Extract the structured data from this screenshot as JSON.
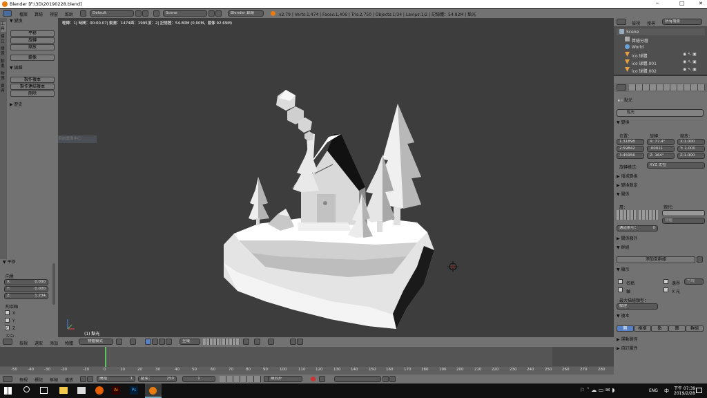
{
  "window": {
    "title": "Blender [F:\\3D\\20190228.blend]",
    "min": "─",
    "max": "□",
    "close": "✕"
  },
  "topbar": {
    "menu": [
      "檔案",
      "算繪",
      "視窗",
      "幫助"
    ],
    "layout": "Default",
    "scene": "Scene",
    "engine": "Blender 算繪",
    "stats": "v2.79 | Verts:1,474 | Faces:1,406 | Tris:2,750 | Objects:1/34 | Lamps:1/2 | 記憶體：54.82M | 點光"
  },
  "toolshelf": {
    "tabs": [
      "工具",
      "建立",
      "關係",
      "動畫",
      "物理",
      "寶典"
    ],
    "transform_header": "▼ 變換",
    "transform": [
      "平移",
      "旋轉",
      "縮放"
    ],
    "mirror": "鏡像",
    "edit_header": "▼ 編輯",
    "edit": [
      "製作複本",
      "製作連結複本",
      "刪除"
    ],
    "history": "▶ 歷史",
    "op_header": "▼ 平移",
    "vector": "向量",
    "x_label": "X:",
    "x_val": "0.000",
    "y_label": "Y:",
    "y_val": "0.000",
    "z_label": "Z:",
    "z_val": "1.234",
    "constraint": "約束軸",
    "axes": [
      "X",
      "Y",
      "Z"
    ],
    "orient": "方向"
  },
  "viewport": {
    "info": "輕轉：1| 時間：00:00.07| 動畫：1474面：1995頂：2| 記憶體：54.80M (0.00M，鏡像 92.69M)",
    "tooltip": "在目前畫面中心",
    "obj_label": "(1) 點光"
  },
  "vp_header": {
    "menu": [
      "檢視",
      "選取",
      "添加",
      "物體"
    ],
    "mode": "物體模式",
    "global": "全域"
  },
  "outliner": {
    "menu": [
      "檢視",
      "搜尋"
    ],
    "filter": "所有場景",
    "items": [
      {
        "label": "Scene"
      },
      {
        "label": "算繪分層"
      },
      {
        "label": "World"
      },
      {
        "label": "ico 球體"
      },
      {
        "label": "ico 球體.001"
      },
      {
        "label": "ico 球體.002"
      }
    ]
  },
  "props": {
    "obj_name": "點光",
    "data_name": "點光",
    "transform": "▼ 變換",
    "loc": "位置：",
    "rot": "旋轉：",
    "scale": "縮放：",
    "loc_vals": [
      "1.31898",
      "2.59842",
      "3.45956"
    ],
    "rot_vals": [
      "X: 77.4°",
      ".00011",
      "Z: 164°"
    ],
    "scale_vals": [
      "X:1.000",
      "Y: 1.000",
      "Z:1.000"
    ],
    "rot_mode_label": "旋轉模式：",
    "rot_mode": "XYZ 尤拉",
    "delta": "▶ 增減變換",
    "lock": "▶ 變換鎖定",
    "relations": "▼ 關係",
    "layers": "層：",
    "parent": "親代：",
    "parent_type": "物體",
    "pass_index": "通道索引：",
    "pass_val": "0",
    "rel_extra": "▶ 關係額外",
    "groups": "▼ 群組",
    "add_group": "添加至群組",
    "display": "▼ 顯示",
    "name_cb": "名稱",
    "axis_cb": "軸",
    "bounds_cb": "邊界",
    "xray_cb": "X 光",
    "shape": "方塊",
    "maxdraw": "最大描繪類型：",
    "maxdraw_val": "紋理",
    "dup": "▼ 複本",
    "dup_tabs": [
      "無",
      "框格",
      "點",
      "面",
      "群組"
    ],
    "motion": "▶ 運動路徑",
    "custom": "▶ 自訂屬性"
  },
  "timeline": {
    "ticks": [
      "-50",
      "-40",
      "-30",
      "-20",
      "-10",
      "0",
      "10",
      "20",
      "30",
      "40",
      "50",
      "60",
      "70",
      "80",
      "90",
      "100",
      "110",
      "120",
      "130",
      "140",
      "150",
      "160",
      "170",
      "180",
      "190",
      "200",
      "210",
      "220",
      "230",
      "240",
      "250",
      "260",
      "270",
      "280"
    ],
    "menu": [
      "檢視",
      "標記",
      "框幀",
      "播放"
    ],
    "start_label": "開始：",
    "start": "1",
    "end_label": "結束：",
    "end": "250",
    "current": "1",
    "sync": "無同步"
  },
  "taskbar": {
    "time": "下午 07:39",
    "date": "2019/2/28",
    "lang": "ENG"
  },
  "colors": {
    "viewport": "#3d3d3d",
    "panel": "#727272",
    "accent": "#5680c2"
  }
}
